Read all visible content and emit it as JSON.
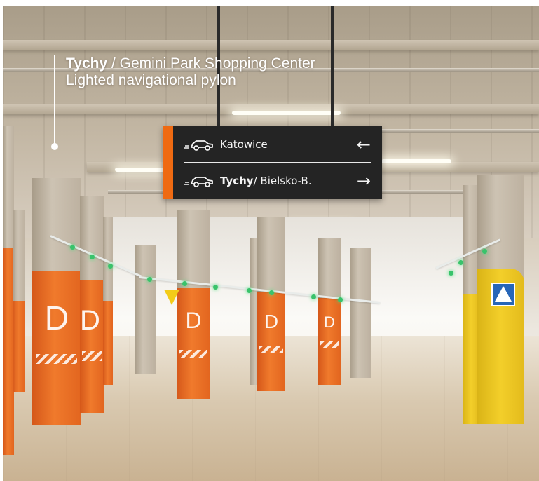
{
  "caption": {
    "city": "Tychy",
    "separator": " / ",
    "place": "Gemini Park Shopping Center",
    "description": "Lighted navigational pylon"
  },
  "sign": {
    "rows": [
      {
        "icon": "car-icon",
        "city": "Katowice",
        "suffix": "",
        "arrow": "←"
      },
      {
        "icon": "car-icon",
        "city": "Tychy",
        "suffix": " / Bielsko-B.",
        "arrow": "→"
      }
    ],
    "accent_color": "#ef6a12",
    "background_color": "#242424"
  },
  "pillars": {
    "zone_letter": "D",
    "band_colors": {
      "orange": "#ef6a12",
      "yellow": "#f3cf2a"
    }
  },
  "pedestrian_sign": {
    "icon": "pedestrian-crossing-icon",
    "color": "#2766b8"
  }
}
